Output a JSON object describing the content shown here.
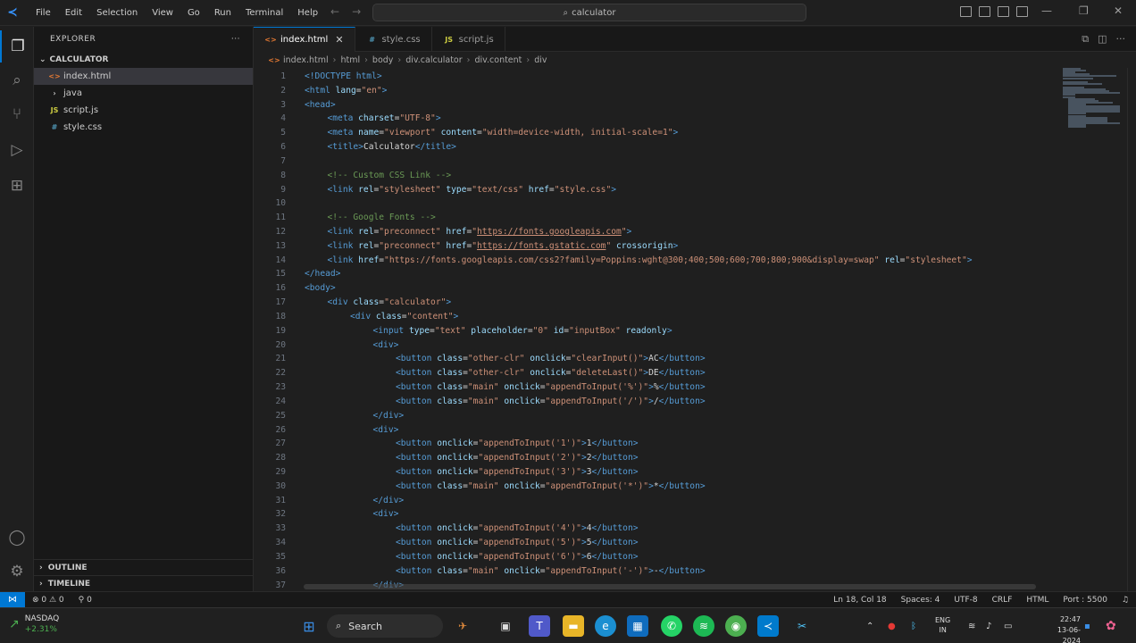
{
  "titlebar": {
    "menu": [
      "File",
      "Edit",
      "Selection",
      "View",
      "Go",
      "Run",
      "Terminal",
      "Help"
    ],
    "search": "calculator"
  },
  "sidebar": {
    "title": "EXPLORER",
    "folder": "CALCULATOR",
    "files": [
      {
        "name": "index.html",
        "icon": "html"
      },
      {
        "name": "java",
        "icon": "folder"
      },
      {
        "name": "script.js",
        "icon": "js"
      },
      {
        "name": "style.css",
        "icon": "css"
      }
    ],
    "outline": "OUTLINE",
    "timeline": "TIMELINE"
  },
  "tabs": [
    {
      "label": "index.html",
      "icon": "html",
      "active": true
    },
    {
      "label": "style.css",
      "icon": "css",
      "active": false
    },
    {
      "label": "script.js",
      "icon": "js",
      "active": false
    }
  ],
  "breadcrumb": [
    "index.html",
    "html",
    "body",
    "div.calculator",
    "div.content",
    "div"
  ],
  "code_lines": [
    {
      "n": "1",
      "indent": 0,
      "parts": [
        [
          "tg",
          "<!DOCTYPE html>"
        ]
      ]
    },
    {
      "n": "2",
      "indent": 0,
      "parts": [
        [
          "tg",
          "<html "
        ],
        [
          "at",
          "lang"
        ],
        [
          "tx",
          "="
        ],
        [
          "st",
          "\"en\""
        ],
        [
          "tg",
          ">"
        ]
      ]
    },
    {
      "n": "3",
      "indent": 0,
      "parts": [
        [
          "tg",
          "<head>"
        ]
      ]
    },
    {
      "n": "4",
      "indent": 1,
      "parts": [
        [
          "tg",
          "<meta "
        ],
        [
          "at",
          "charset"
        ],
        [
          "tx",
          "="
        ],
        [
          "st",
          "\"UTF-8\""
        ],
        [
          "tg",
          ">"
        ]
      ]
    },
    {
      "n": "5",
      "indent": 1,
      "parts": [
        [
          "tg",
          "<meta "
        ],
        [
          "at",
          "name"
        ],
        [
          "tx",
          "="
        ],
        [
          "st",
          "\"viewport\" "
        ],
        [
          "at",
          "content"
        ],
        [
          "tx",
          "="
        ],
        [
          "st",
          "\"width=device-width, initial-scale=1\""
        ],
        [
          "tg",
          ">"
        ]
      ]
    },
    {
      "n": "6",
      "indent": 1,
      "parts": [
        [
          "tg",
          "<title>"
        ],
        [
          "tx",
          "Calculator"
        ],
        [
          "tg",
          "</title>"
        ]
      ]
    },
    {
      "n": "7",
      "indent": 0,
      "parts": []
    },
    {
      "n": "8",
      "indent": 1,
      "parts": [
        [
          "cm",
          "<!-- Custom CSS Link -->"
        ]
      ]
    },
    {
      "n": "9",
      "indent": 1,
      "parts": [
        [
          "tg",
          "<link "
        ],
        [
          "at",
          "rel"
        ],
        [
          "tx",
          "="
        ],
        [
          "st",
          "\"stylesheet\" "
        ],
        [
          "at",
          "type"
        ],
        [
          "tx",
          "="
        ],
        [
          "st",
          "\"text/css\" "
        ],
        [
          "at",
          "href"
        ],
        [
          "tx",
          "="
        ],
        [
          "st",
          "\"style.css\""
        ],
        [
          "tg",
          ">"
        ]
      ]
    },
    {
      "n": "10",
      "indent": 0,
      "parts": []
    },
    {
      "n": "11",
      "indent": 1,
      "parts": [
        [
          "cm",
          "<!-- Google Fonts -->"
        ]
      ]
    },
    {
      "n": "12",
      "indent": 1,
      "parts": [
        [
          "tg",
          "<link "
        ],
        [
          "at",
          "rel"
        ],
        [
          "tx",
          "="
        ],
        [
          "st",
          "\"preconnect\" "
        ],
        [
          "at",
          "href"
        ],
        [
          "tx",
          "="
        ],
        [
          "st",
          "\""
        ],
        [
          "stu",
          "https://fonts.googleapis.com"
        ],
        [
          "st",
          "\""
        ],
        [
          "tg",
          ">"
        ]
      ]
    },
    {
      "n": "13",
      "indent": 1,
      "parts": [
        [
          "tg",
          "<link "
        ],
        [
          "at",
          "rel"
        ],
        [
          "tx",
          "="
        ],
        [
          "st",
          "\"preconnect\" "
        ],
        [
          "at",
          "href"
        ],
        [
          "tx",
          "="
        ],
        [
          "st",
          "\""
        ],
        [
          "stu",
          "https://fonts.gstatic.com"
        ],
        [
          "st",
          "\" "
        ],
        [
          "at",
          "crossorigin"
        ],
        [
          "tg",
          ">"
        ]
      ]
    },
    {
      "n": "14",
      "indent": 1,
      "parts": [
        [
          "tg",
          "<link "
        ],
        [
          "at",
          "href"
        ],
        [
          "tx",
          "="
        ],
        [
          "st",
          "\"https://fonts.googleapis.com/css2?family=Poppins:wght@300;400;500;600;700;800;900&display=swap\" "
        ],
        [
          "at",
          "rel"
        ],
        [
          "tx",
          "="
        ],
        [
          "st",
          "\"stylesheet\""
        ],
        [
          "tg",
          ">"
        ]
      ]
    },
    {
      "n": "15",
      "indent": 0,
      "parts": [
        [
          "tg",
          "</head>"
        ]
      ]
    },
    {
      "n": "16",
      "indent": 0,
      "parts": [
        [
          "tg",
          "<body>"
        ]
      ]
    },
    {
      "n": "17",
      "indent": 1,
      "parts": [
        [
          "tg",
          "<div "
        ],
        [
          "at",
          "class"
        ],
        [
          "tx",
          "="
        ],
        [
          "st",
          "\"calculator\""
        ],
        [
          "tg",
          ">"
        ]
      ]
    },
    {
      "n": "18",
      "indent": 2,
      "parts": [
        [
          "tg",
          "<div "
        ],
        [
          "at",
          "class"
        ],
        [
          "tx",
          "="
        ],
        [
          "st",
          "\"content\""
        ],
        [
          "tg",
          ">"
        ]
      ]
    },
    {
      "n": "19",
      "indent": 3,
      "parts": [
        [
          "tg",
          "<input "
        ],
        [
          "at",
          "type"
        ],
        [
          "tx",
          "="
        ],
        [
          "st",
          "\"text\" "
        ],
        [
          "at",
          "placeholder"
        ],
        [
          "tx",
          "="
        ],
        [
          "st",
          "\"0\" "
        ],
        [
          "at",
          "id"
        ],
        [
          "tx",
          "="
        ],
        [
          "st",
          "\"inputBox\" "
        ],
        [
          "at",
          "readonly"
        ],
        [
          "tg",
          ">"
        ]
      ]
    },
    {
      "n": "20",
      "indent": 3,
      "parts": [
        [
          "tg",
          "<div>"
        ]
      ]
    },
    {
      "n": "21",
      "indent": 4,
      "parts": [
        [
          "tg",
          "<button "
        ],
        [
          "at",
          "class"
        ],
        [
          "tx",
          "="
        ],
        [
          "st",
          "\"other-clr\" "
        ],
        [
          "at",
          "onclick"
        ],
        [
          "tx",
          "="
        ],
        [
          "st",
          "\"clearInput()\""
        ],
        [
          "tg",
          ">"
        ],
        [
          "tx",
          "AC"
        ],
        [
          "tg",
          "</button>"
        ]
      ]
    },
    {
      "n": "22",
      "indent": 4,
      "parts": [
        [
          "tg",
          "<button "
        ],
        [
          "at",
          "class"
        ],
        [
          "tx",
          "="
        ],
        [
          "st",
          "\"other-clr\" "
        ],
        [
          "at",
          "onclick"
        ],
        [
          "tx",
          "="
        ],
        [
          "st",
          "\"deleteLast()\""
        ],
        [
          "tg",
          ">"
        ],
        [
          "tx",
          "DE"
        ],
        [
          "tg",
          "</button>"
        ]
      ]
    },
    {
      "n": "23",
      "indent": 4,
      "parts": [
        [
          "tg",
          "<button "
        ],
        [
          "at",
          "class"
        ],
        [
          "tx",
          "="
        ],
        [
          "st",
          "\"main\" "
        ],
        [
          "at",
          "onclick"
        ],
        [
          "tx",
          "="
        ],
        [
          "st",
          "\"appendToInput('%')\""
        ],
        [
          "tg",
          ">"
        ],
        [
          "tx",
          "%"
        ],
        [
          "tg",
          "</button>"
        ]
      ]
    },
    {
      "n": "24",
      "indent": 4,
      "parts": [
        [
          "tg",
          "<button "
        ],
        [
          "at",
          "class"
        ],
        [
          "tx",
          "="
        ],
        [
          "st",
          "\"main\" "
        ],
        [
          "at",
          "onclick"
        ],
        [
          "tx",
          "="
        ],
        [
          "st",
          "\"appendToInput('/')\""
        ],
        [
          "tg",
          ">"
        ],
        [
          "tx",
          "/"
        ],
        [
          "tg",
          "</button>"
        ]
      ]
    },
    {
      "n": "25",
      "indent": 3,
      "parts": [
        [
          "tg",
          "</div>"
        ]
      ]
    },
    {
      "n": "26",
      "indent": 3,
      "parts": [
        [
          "tg",
          "<div>"
        ]
      ]
    },
    {
      "n": "27",
      "indent": 4,
      "parts": [
        [
          "tg",
          "<button "
        ],
        [
          "at",
          "onclick"
        ],
        [
          "tx",
          "="
        ],
        [
          "st",
          "\"appendToInput('1')\""
        ],
        [
          "tg",
          ">"
        ],
        [
          "tx",
          "1"
        ],
        [
          "tg",
          "</button>"
        ]
      ]
    },
    {
      "n": "28",
      "indent": 4,
      "parts": [
        [
          "tg",
          "<button "
        ],
        [
          "at",
          "onclick"
        ],
        [
          "tx",
          "="
        ],
        [
          "st",
          "\"appendToInput('2')\""
        ],
        [
          "tg",
          ">"
        ],
        [
          "tx",
          "2"
        ],
        [
          "tg",
          "</button>"
        ]
      ]
    },
    {
      "n": "29",
      "indent": 4,
      "parts": [
        [
          "tg",
          "<button "
        ],
        [
          "at",
          "onclick"
        ],
        [
          "tx",
          "="
        ],
        [
          "st",
          "\"appendToInput('3')\""
        ],
        [
          "tg",
          ">"
        ],
        [
          "tx",
          "3"
        ],
        [
          "tg",
          "</button>"
        ]
      ]
    },
    {
      "n": "30",
      "indent": 4,
      "parts": [
        [
          "tg",
          "<button "
        ],
        [
          "at",
          "class"
        ],
        [
          "tx",
          "="
        ],
        [
          "st",
          "\"main\" "
        ],
        [
          "at",
          "onclick"
        ],
        [
          "tx",
          "="
        ],
        [
          "st",
          "\"appendToInput('*')\""
        ],
        [
          "tg",
          ">"
        ],
        [
          "tx",
          "*"
        ],
        [
          "tg",
          "</button>"
        ]
      ]
    },
    {
      "n": "31",
      "indent": 3,
      "parts": [
        [
          "tg",
          "</div>"
        ]
      ]
    },
    {
      "n": "32",
      "indent": 3,
      "parts": [
        [
          "tg",
          "<div>"
        ]
      ]
    },
    {
      "n": "33",
      "indent": 4,
      "parts": [
        [
          "tg",
          "<button "
        ],
        [
          "at",
          "onclick"
        ],
        [
          "tx",
          "="
        ],
        [
          "st",
          "\"appendToInput('4')\""
        ],
        [
          "tg",
          ">"
        ],
        [
          "tx",
          "4"
        ],
        [
          "tg",
          "</button>"
        ]
      ]
    },
    {
      "n": "34",
      "indent": 4,
      "parts": [
        [
          "tg",
          "<button "
        ],
        [
          "at",
          "onclick"
        ],
        [
          "tx",
          "="
        ],
        [
          "st",
          "\"appendToInput('5')\""
        ],
        [
          "tg",
          ">"
        ],
        [
          "tx",
          "5"
        ],
        [
          "tg",
          "</button>"
        ]
      ]
    },
    {
      "n": "35",
      "indent": 4,
      "parts": [
        [
          "tg",
          "<button "
        ],
        [
          "at",
          "onclick"
        ],
        [
          "tx",
          "="
        ],
        [
          "st",
          "\"appendToInput('6')\""
        ],
        [
          "tg",
          ">"
        ],
        [
          "tx",
          "6"
        ],
        [
          "tg",
          "</button>"
        ]
      ]
    },
    {
      "n": "36",
      "indent": 4,
      "parts": [
        [
          "tg",
          "<button "
        ],
        [
          "at",
          "class"
        ],
        [
          "tx",
          "="
        ],
        [
          "st",
          "\"main\" "
        ],
        [
          "at",
          "onclick"
        ],
        [
          "tx",
          "="
        ],
        [
          "st",
          "\"appendToInput('-')\""
        ],
        [
          "tg",
          ">"
        ],
        [
          "tx",
          "-"
        ],
        [
          "tg",
          "</button>"
        ]
      ]
    },
    {
      "n": "37",
      "indent": 3,
      "parts": [
        [
          "tg",
          "</div>"
        ]
      ]
    }
  ],
  "statusbar": {
    "problems": "⊗ 0 ⚠ 0",
    "ports": "⚲ 0",
    "position": "Ln 18, Col 18",
    "spaces": "Spaces: 4",
    "encoding": "UTF-8",
    "eol": "CRLF",
    "language": "HTML",
    "port": "Port : 5500"
  },
  "taskbar": {
    "widget_title": "NASDAQ",
    "widget_change": "+2.31%",
    "search": "Search",
    "lang_line1": "ENG",
    "lang_line2": "IN",
    "time": "22:47",
    "date": "13-06-2024"
  },
  "colors": {
    "accent": "#0078d4",
    "tag": "#569cd6",
    "attribute": "#9cdcfe",
    "string": "#ce9178",
    "comment": "#6a9955"
  }
}
